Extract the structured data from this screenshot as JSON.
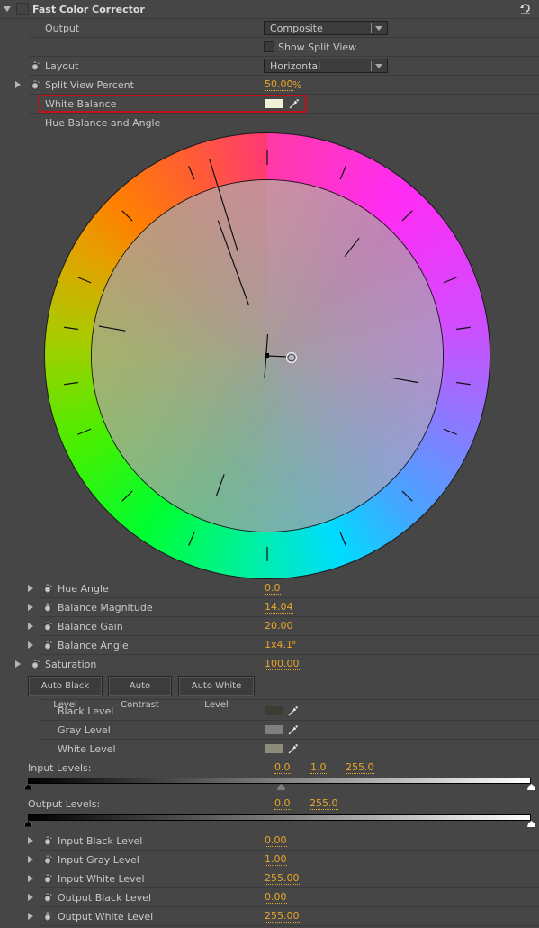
{
  "header": {
    "title": "Fast Color Corrector",
    "reset_icon": "reset-icon"
  },
  "output": {
    "label": "Output",
    "value": "Composite"
  },
  "split_view": {
    "label": "Show Split View",
    "checked": false
  },
  "layout": {
    "label": "Layout",
    "value": "Horizontal"
  },
  "split_view_percent": {
    "label": "Split View Percent",
    "value": "50.00",
    "unit": "%"
  },
  "white_balance": {
    "label": "White Balance",
    "color": "#f2f0d8"
  },
  "hue_balance": {
    "label": "Hue Balance and Angle",
    "wheel": {
      "hue_angle_deg": 0.0,
      "balance_magnitude": 14.04,
      "balance_angle": "1x4.1"
    }
  },
  "params": [
    {
      "label": "Hue Angle",
      "value": "0.0",
      "unit": ""
    },
    {
      "label": "Balance Magnitude",
      "value": "14.04",
      "unit": ""
    },
    {
      "label": "Balance Gain",
      "value": "20.00",
      "unit": ""
    },
    {
      "label": "Balance Angle",
      "value": "1x4.1",
      "unit": "°"
    }
  ],
  "saturation": {
    "label": "Saturation",
    "value": "100.00"
  },
  "buttons": {
    "auto_black": "Auto Black Level",
    "auto_contrast": "Auto Contrast",
    "auto_white": "Auto White Level"
  },
  "levels": [
    {
      "label": "Black Level",
      "color": "#3c3c32"
    },
    {
      "label": "Gray Level",
      "color": "#7f7f7f"
    },
    {
      "label": "White Level",
      "color": "#8c8c78"
    }
  ],
  "input_levels": {
    "label": "Input Levels:",
    "black": "0.0",
    "gray": "1.0",
    "white": "255.0"
  },
  "output_levels": {
    "label": "Output Levels:",
    "black": "0.0",
    "white": "255.0"
  },
  "level_params": [
    {
      "label": "Input Black Level",
      "value": "0.00"
    },
    {
      "label": "Input Gray Level",
      "value": "1.00"
    },
    {
      "label": "Input White Level",
      "value": "255.00"
    },
    {
      "label": "Output Black Level",
      "value": "0.00"
    },
    {
      "label": "Output White Level",
      "value": "255.00"
    }
  ]
}
